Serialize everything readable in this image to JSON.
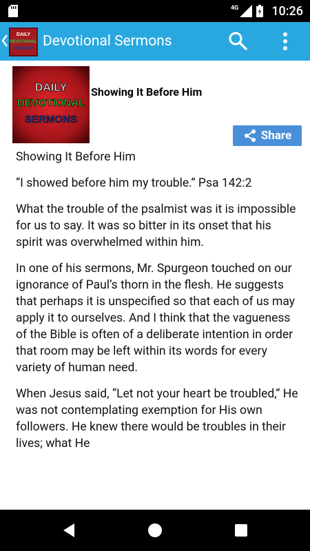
{
  "status_bar": {
    "network_label": "4G",
    "time": "10:26"
  },
  "app_bar": {
    "title": "Devotional Sermons",
    "logo_text": [
      "DAILY",
      "DEVOTIONAL",
      "SERMONS"
    ],
    "colors": {
      "background": "#29a8e0"
    }
  },
  "post": {
    "logo_text": [
      "DAILY",
      "DEVOTIONAL",
      "SERMONS"
    ],
    "title": "Showing It Before Him",
    "share_label": "Share",
    "paragraphs": [
      "Showing It Before Him",
      "“I showed before him my trouble.” Psa 142:2",
      "What the trouble of the psalmist was it is impossible for us to say. It was so bitter in its onset that his spirit was overwhelmed within him.",
      "In one of his sermons, Mr. Spurgeon touched on our ignorance of Paul’s thorn in the flesh. He suggests that perhaps it is unspecified so that each of us may apply it to ourselves. And I think that the vagueness of the Bible is often of a deliberate intention in order that room may be left within its words for every variety of human need.",
      "When Jesus said, “Let not your heart be troubled,” He was not contemplating exemption for His own followers. He knew there would be troubles in their lives; what He"
    ]
  },
  "icons": {
    "status": [
      "sd-card-icon",
      "signal-icon",
      "battery-icon"
    ],
    "app_bar": [
      "back-icon",
      "search-icon",
      "overflow-menu-icon"
    ],
    "nav": [
      "back-triangle-icon",
      "home-circle-icon",
      "recents-square-icon"
    ]
  }
}
